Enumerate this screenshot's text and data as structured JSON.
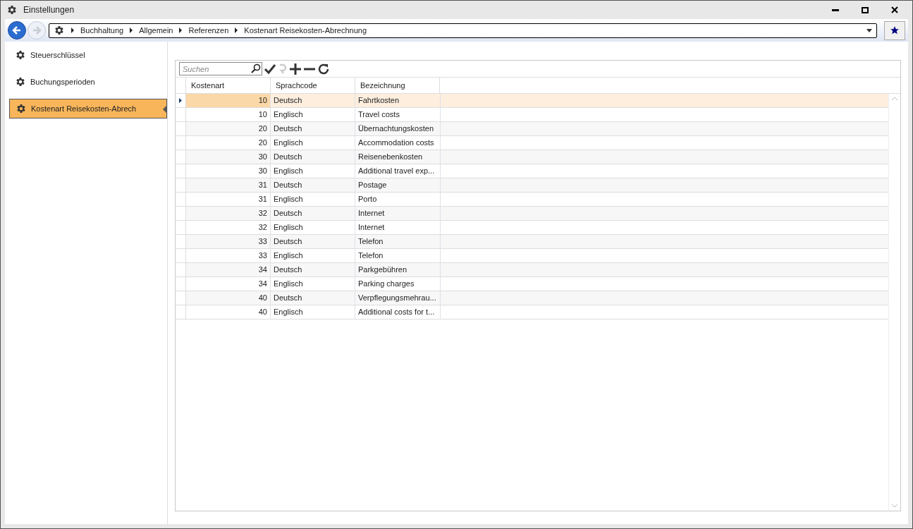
{
  "window": {
    "title": "Einstellungen"
  },
  "breadcrumb": [
    "Buchhaltung",
    "Allgemein",
    "Referenzen",
    "Kostenart Reisekosten-Abrechnung"
  ],
  "sidebar": {
    "items": [
      {
        "label": "Steuerschlüssel",
        "selected": false
      },
      {
        "label": "Buchungsperioden",
        "selected": false
      },
      {
        "label": "Kostenart Reisekosten-Abrech",
        "selected": true
      }
    ]
  },
  "search": {
    "placeholder": "Suchen"
  },
  "table": {
    "columns": [
      "Kostenart",
      "Sprachcode",
      "Bezeichnung"
    ],
    "rows": [
      {
        "cells": [
          "10",
          "Deutsch",
          "Fahrtkosten"
        ],
        "selected": true
      },
      {
        "cells": [
          "10",
          "Englisch",
          "Travel costs"
        ],
        "selected": false
      },
      {
        "cells": [
          "20",
          "Deutsch",
          "Übernachtungskosten"
        ],
        "selected": false
      },
      {
        "cells": [
          "20",
          "Englisch",
          "Accommodation costs"
        ],
        "selected": false
      },
      {
        "cells": [
          "30",
          "Deutsch",
          "Reisenebenkosten"
        ],
        "selected": false
      },
      {
        "cells": [
          "30",
          "Englisch",
          "Additional travel exp..."
        ],
        "selected": false
      },
      {
        "cells": [
          "31",
          "Deutsch",
          "Postage"
        ],
        "selected": false
      },
      {
        "cells": [
          "31",
          "Englisch",
          "Porto"
        ],
        "selected": false
      },
      {
        "cells": [
          "32",
          "Deutsch",
          "Internet"
        ],
        "selected": false
      },
      {
        "cells": [
          "32",
          "Englisch",
          "Internet"
        ],
        "selected": false
      },
      {
        "cells": [
          "33",
          "Deutsch",
          "Telefon"
        ],
        "selected": false
      },
      {
        "cells": [
          "33",
          "Englisch",
          "Telefon"
        ],
        "selected": false
      },
      {
        "cells": [
          "34",
          "Deutsch",
          "Parkgebühren"
        ],
        "selected": false
      },
      {
        "cells": [
          "34",
          "Englisch",
          "Parking charges"
        ],
        "selected": false
      },
      {
        "cells": [
          "40",
          "Deutsch",
          "Verpflegungsmehrau..."
        ],
        "selected": false
      },
      {
        "cells": [
          "40",
          "Englisch",
          "Additional costs for t..."
        ],
        "selected": false
      }
    ]
  }
}
